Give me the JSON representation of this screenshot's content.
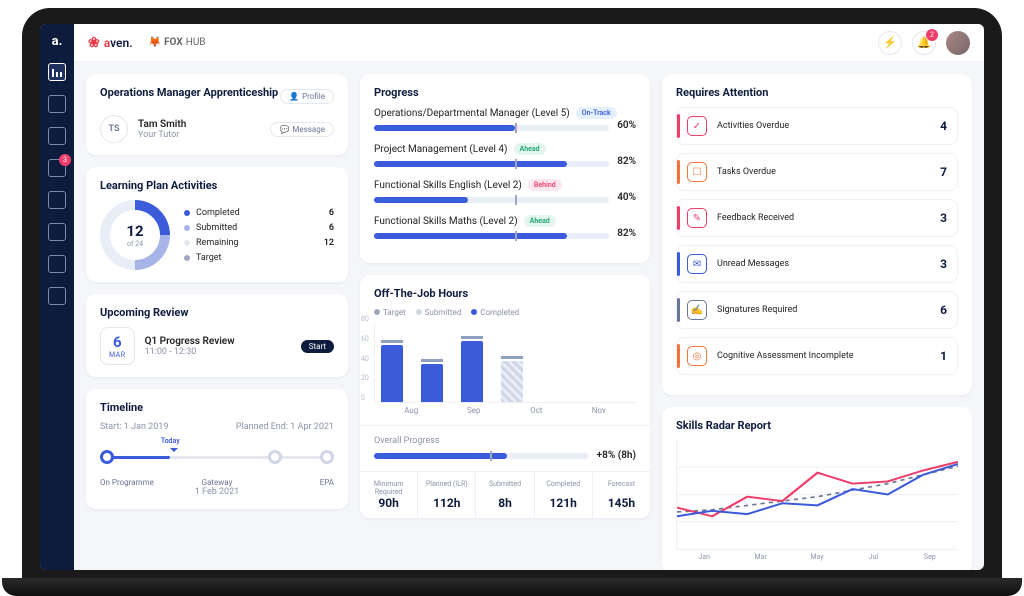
{
  "brand": {
    "name1_a": "a",
    "name1_b": "ven.",
    "name2_a": "FOX",
    "name2_b": "HUB",
    "logo": "a."
  },
  "topbar": {
    "notif_count": "2"
  },
  "sidebar": {
    "msg_count": "3"
  },
  "header_card": {
    "title": "Operations Manager Apprenticeship",
    "profile_btn": "Profile",
    "tutor_initials": "TS",
    "tutor_name": "Tam Smith",
    "tutor_role": "Your Tutor",
    "message_btn": "Message"
  },
  "activities": {
    "title": "Learning Plan Activities",
    "center_num": "12",
    "center_sub": "of 24",
    "rows": [
      {
        "label": "Completed",
        "val": "6",
        "color": "#3b5bdb"
      },
      {
        "label": "Submitted",
        "val": "6",
        "color": "#a7b4e8"
      },
      {
        "label": "Remaining",
        "val": "12",
        "color": "#e4e7ef"
      },
      {
        "label": "Target",
        "val": "",
        "color": "#9fa8bd"
      }
    ]
  },
  "review": {
    "title": "Upcoming Review",
    "day": "6",
    "month": "MAR",
    "name": "Q1 Progress Review",
    "time": "11:00 - 12:30",
    "btn": "Start"
  },
  "timeline": {
    "title": "Timeline",
    "start_lbl": "Start: 1 Jan 2019",
    "end_lbl": "Planned End: 1 Apr 2021",
    "today": "Today",
    "p0": "On Programme",
    "p1": "Gateway",
    "p1_sub": "1 Feb 2021",
    "p2": "EPA"
  },
  "progress": {
    "title": "Progress",
    "items": [
      {
        "name": "Operations/Departmental Manager (Level 5)",
        "status": "On-Track",
        "cls": "ontrack",
        "pct": 60,
        "pct_lbl": "60%"
      },
      {
        "name": "Project Management (Level 4)",
        "status": "Ahead",
        "cls": "ahead",
        "pct": 82,
        "pct_lbl": "82%"
      },
      {
        "name": "Functional Skills English (Level 2)",
        "status": "Behind",
        "cls": "behind",
        "pct": 40,
        "pct_lbl": "40%"
      },
      {
        "name": "Functional Skills Maths (Level 2)",
        "status": "Ahead",
        "cls": "ahead",
        "pct": 82,
        "pct_lbl": "82%"
      }
    ]
  },
  "otj": {
    "title": "Off-The-Job Hours",
    "legend": {
      "t": "Target",
      "s": "Submitted",
      "c": "Completed"
    },
    "overall_lbl": "Overall Progress",
    "overall_delta": "+8% (8h)",
    "stats": [
      {
        "l": "Minimum Required",
        "v": "90h"
      },
      {
        "l": "Planned (ILR)",
        "v": "112h"
      },
      {
        "l": "Submitted",
        "v": "8h"
      },
      {
        "l": "Completed",
        "v": "121h"
      },
      {
        "l": "Forecast",
        "v": "145h"
      }
    ]
  },
  "chart_data": {
    "type": "bar",
    "categories": [
      "Aug",
      "Sep",
      "Oct",
      "Nov"
    ],
    "series": [
      {
        "name": "Target",
        "values": [
          48,
          48,
          48,
          48
        ]
      },
      {
        "name": "Submitted",
        "values": [
          0,
          0,
          0,
          8
        ]
      },
      {
        "name": "Completed",
        "values": [
          58,
          38,
          62,
          42
        ]
      }
    ],
    "ylim": [
      0,
      80
    ],
    "yticks": [
      0,
      20,
      40,
      60,
      80
    ]
  },
  "attention": {
    "title": "Requires Attention",
    "items": [
      {
        "label": "Activities Overdue",
        "n": "4",
        "color": "#ef3e6a",
        "glyph": "✓"
      },
      {
        "label": "Tasks Overdue",
        "n": "7",
        "color": "#f4743b",
        "glyph": "☐"
      },
      {
        "label": "Feedback Received",
        "n": "3",
        "color": "#ef3e6a",
        "glyph": "✎"
      },
      {
        "label": "Unread Messages",
        "n": "3",
        "color": "#3b5bdb",
        "glyph": "✉"
      },
      {
        "label": "Signatures Required",
        "n": "6",
        "color": "#6b7694",
        "glyph": "✍"
      },
      {
        "label": "Cognitive Assessment Incomplete",
        "n": "1",
        "color": "#f4743b",
        "glyph": "◎"
      }
    ]
  },
  "radar": {
    "title": "Skills Radar Report",
    "x": [
      "Jan",
      "Mar",
      "May",
      "Jul",
      "Sep"
    ],
    "series": {
      "blue": [
        30,
        35,
        32,
        42,
        40,
        55,
        50,
        68,
        78
      ],
      "pink": [
        38,
        30,
        48,
        44,
        70,
        60,
        62,
        72,
        80
      ],
      "dash": [
        34,
        36,
        40,
        44,
        48,
        54,
        60,
        68,
        76
      ]
    }
  }
}
